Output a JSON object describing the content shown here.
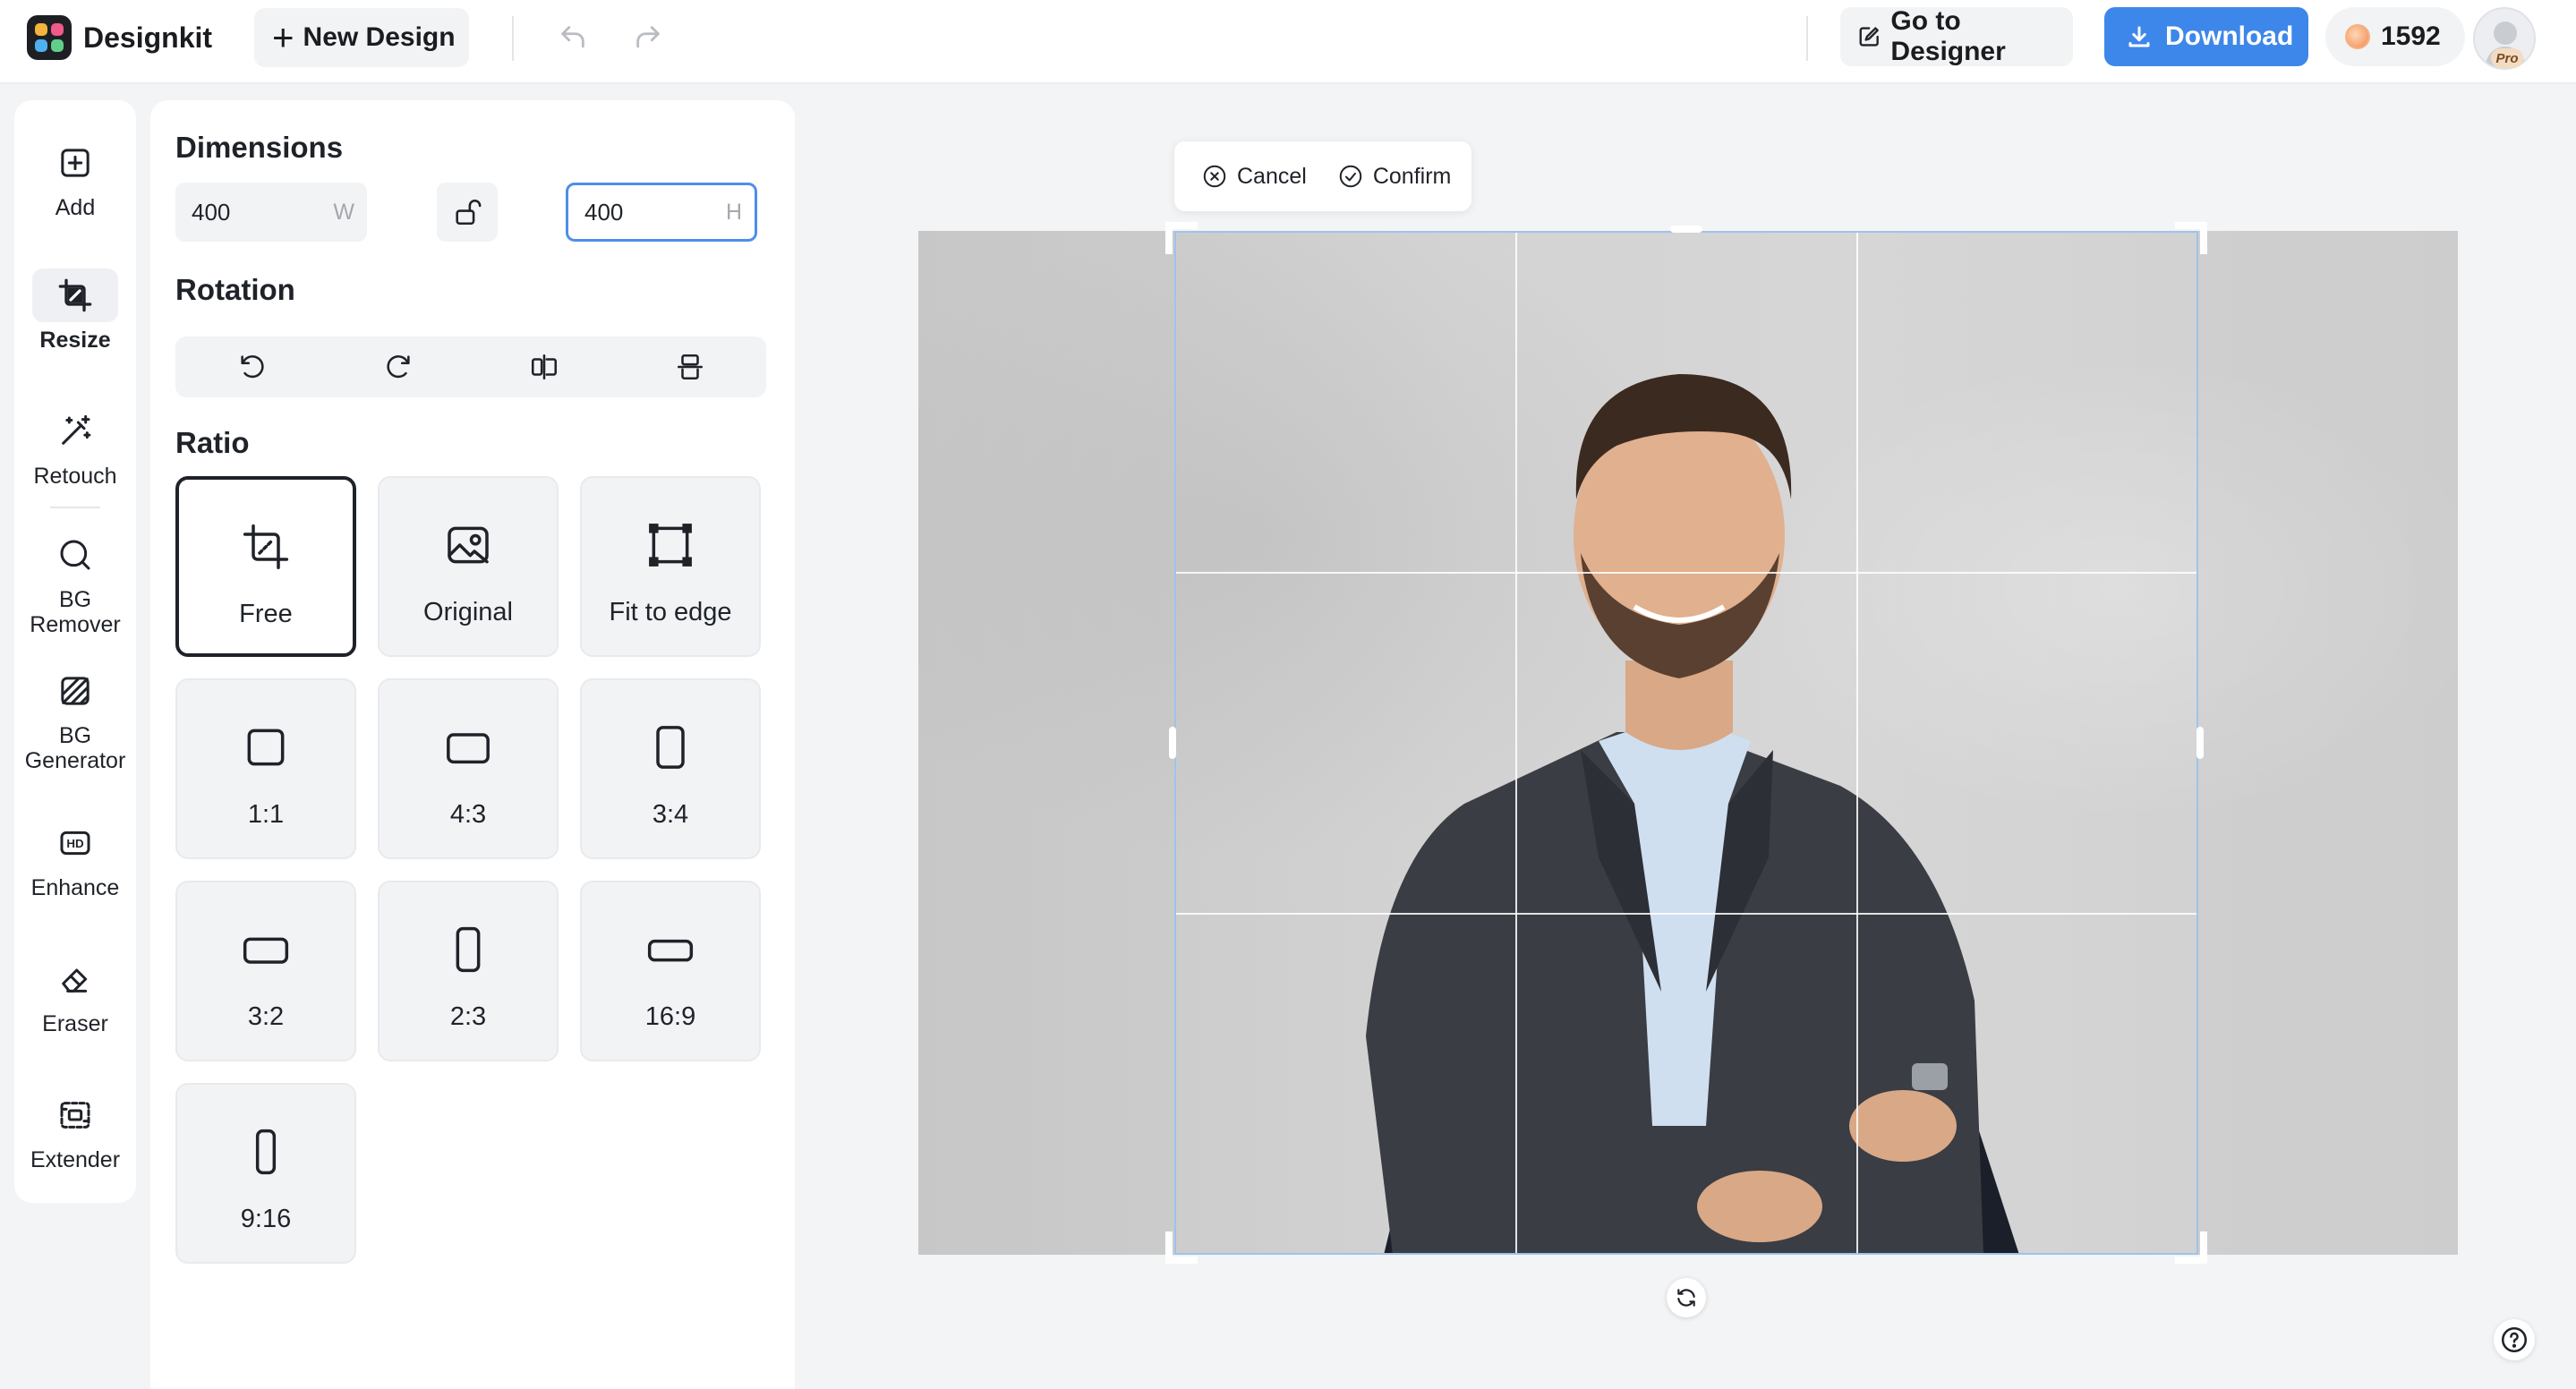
{
  "app": {
    "name": "Designkit"
  },
  "toolbar": {
    "new_design_label": "New Design",
    "go_to_designer_label": "Go to Designer",
    "download_label": "Download",
    "credits": "1592",
    "pro_badge": "Pro"
  },
  "rail": {
    "items": [
      {
        "label": "Add",
        "icon": "plus-square-icon"
      },
      {
        "label": "Resize",
        "icon": "crop-icon",
        "active": true
      },
      {
        "label": "Retouch",
        "icon": "magic-wand-icon"
      },
      {
        "label": "BG Remover",
        "icon": "bg-remover-icon"
      },
      {
        "label": "BG Generator",
        "icon": "bg-generator-icon"
      },
      {
        "label": "Enhance",
        "icon": "hd-icon"
      },
      {
        "label": "Eraser",
        "icon": "eraser-icon"
      },
      {
        "label": "Extender",
        "icon": "extender-icon"
      }
    ]
  },
  "panel": {
    "dimensions_title": "Dimensions",
    "width_value": "400",
    "width_unit": "W",
    "height_value": "400",
    "height_unit": "H",
    "rotation_title": "Rotation",
    "ratio_title": "Ratio",
    "ratios": [
      {
        "label": "Free",
        "selected": true
      },
      {
        "label": "Original"
      },
      {
        "label": "Fit to edge"
      },
      {
        "label": "1:1"
      },
      {
        "label": "4:3"
      },
      {
        "label": "3:4"
      },
      {
        "label": "3:2"
      },
      {
        "label": "2:3"
      },
      {
        "label": "16:9"
      },
      {
        "label": "9:16"
      }
    ]
  },
  "canvas": {
    "cancel_label": "Cancel",
    "confirm_label": "Confirm"
  },
  "colors": {
    "accent": "#3d87ea",
    "crop_border": "#9ec3ec"
  }
}
